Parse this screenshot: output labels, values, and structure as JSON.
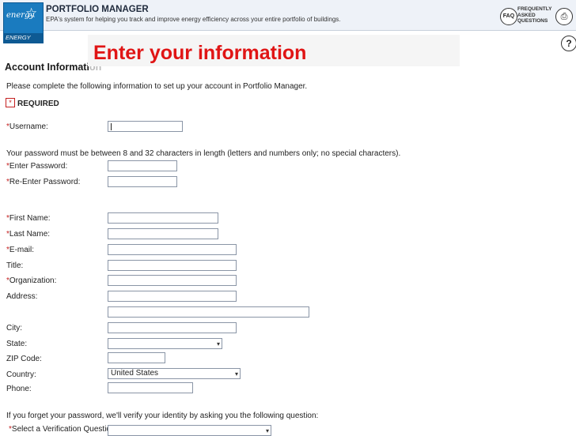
{
  "header": {
    "logo_script": "energy",
    "logo_band": "ENERGY STAR",
    "title": "PORTFOLIO MANAGER",
    "subtitle": "EPA's system for helping you track and improve energy efficiency across your entire portfolio of buildings.",
    "faq_icon_text": "FAQ",
    "faq_text": "FREQUENTLY ASKED QUESTIONS",
    "print_icon": "printer-icon",
    "help_icon_text": "?"
  },
  "overlay": {
    "text": "Enter your information",
    "color": "#e01515"
  },
  "page": {
    "heading": "Account Informati",
    "heading_overflow": "on",
    "intro": "Please complete the following information to set up your account in Portfolio Manager.",
    "required_marker": "*",
    "required_label": "REQUIRED",
    "password_note": "Your password must be between 8 and 32 characters in length (letters and numbers only; no special characters).",
    "forgot_note": "If you forget your password, we'll verify your identity by asking you the following question:"
  },
  "form": {
    "username": {
      "label": "Username:",
      "required": "*"
    },
    "password": {
      "label": "Enter Password:",
      "required": "*"
    },
    "password2": {
      "label": "Re-Enter Password:",
      "required": "*"
    },
    "first_name": {
      "label": "First Name:",
      "required": "*"
    },
    "last_name": {
      "label": "Last Name:",
      "required": "*"
    },
    "email": {
      "label": "E-mail:",
      "required": "*"
    },
    "title": {
      "label": "Title:"
    },
    "organization": {
      "label": "Organization:",
      "required": "*"
    },
    "address": {
      "label": "Address:"
    },
    "city": {
      "label": "City:"
    },
    "state": {
      "label": "State:",
      "value": ""
    },
    "zip": {
      "label": "ZIP Code:"
    },
    "country": {
      "label": "Country:",
      "value": "United States"
    },
    "phone": {
      "label": "Phone:"
    },
    "verification": {
      "label": "Select a Verification Question:",
      "required": "*",
      "value": ""
    }
  }
}
